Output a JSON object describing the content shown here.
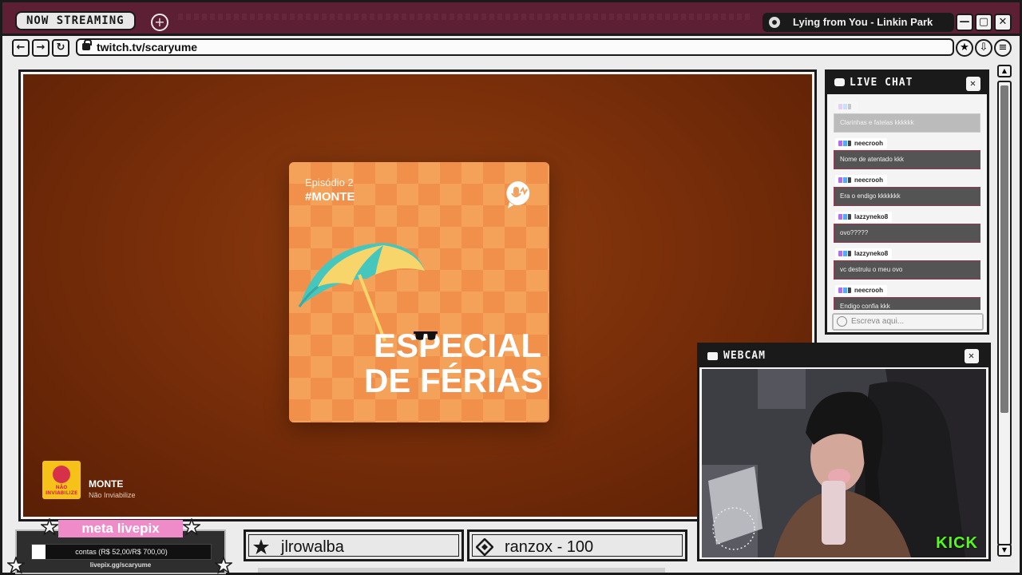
{
  "titlebar": {
    "tab_label": "NOW STREAMING",
    "add_tab": "+",
    "now_playing": "Lying from You - Linkin Park",
    "minimize": "—",
    "maximize": "▢",
    "close": "✕"
  },
  "nav": {
    "back": "←",
    "forward": "→",
    "reload": "↻",
    "url": "twitch.tv/scaryume",
    "star": "★",
    "download": "⇩",
    "menu": "≡"
  },
  "stream": {
    "cover": {
      "episode": "Episódio 2",
      "tag": "#MONTE",
      "title_line1": "ESPECIAL",
      "title_line2": "DE FÉRIAS"
    },
    "podcast": {
      "badge": "NÃO INVIABILIZE",
      "name": "MONTE",
      "subtitle": "Não Inviabilize"
    }
  },
  "chat": {
    "title": "LIVE CHAT",
    "close": "✕",
    "messages": [
      {
        "user": "",
        "text": "Clarinhas e fatelas kkkkkk",
        "faded": true
      },
      {
        "user": "neecrooh",
        "text": "Nome de atentado kkk"
      },
      {
        "user": "neecrooh",
        "text": "Era o endigo kkkkkkk"
      },
      {
        "user": "lazzyneko8",
        "text": "ovo?????"
      },
      {
        "user": "lazzyneko8",
        "text": "vc destruiu o meu ovo"
      },
      {
        "user": "neecrooh",
        "text": "Endigo confia kkk"
      }
    ],
    "input_placeholder": "Escreva aqui..."
  },
  "webcam": {
    "title": "WEBCAM",
    "close": "✕",
    "brand": "KICK"
  },
  "livepix": {
    "title": "meta livepix",
    "goal_text": "contas (R$ 52,00/R$ 700,00)",
    "progress": 0.074,
    "link": "livepix.gg/scaryume"
  },
  "goals": [
    {
      "text": "jlrowalba",
      "icon": "star-icon"
    },
    {
      "text": "ranzox - 100",
      "icon": "diamond-icon"
    }
  ],
  "scrollbar": {
    "up": "▲",
    "down": "▼"
  },
  "colors": {
    "titlebar": "#5c1f33",
    "stream_bg": "#7a2f0a",
    "cover_orange": "#f4a25a",
    "kick_green": "#53fc18",
    "livepix_pink": "#f08bc9"
  }
}
